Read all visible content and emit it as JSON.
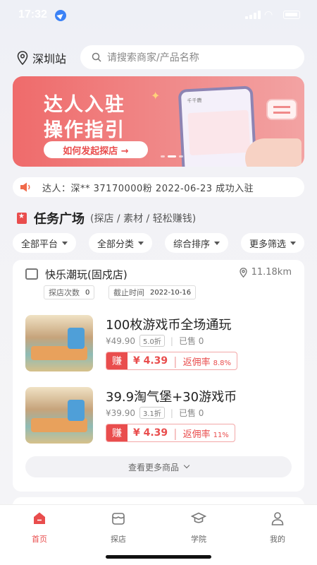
{
  "status": {
    "time": "17:32"
  },
  "header": {
    "city": "深圳站",
    "search_placeholder": "请搜索商家/产品名称"
  },
  "banner": {
    "title_line1": "达人入驻",
    "title_line2": "操作指引",
    "button": "如何发起探店 →",
    "phone_header": "千千鹿"
  },
  "notice": {
    "text": "达人：深**  37170000粉  2022-06-23 成功入驻"
  },
  "section": {
    "title": "任务广场",
    "subtitle": "(探店 / 素材 / 轻松赚钱)"
  },
  "filters": [
    "全部平台",
    "全部分类",
    "综合排序",
    "更多筛选"
  ],
  "store": {
    "name": "快乐潮玩(固戍店)",
    "distance": "11.18km",
    "visits_label": "探店次数",
    "visits_value": "0",
    "deadline_label": "截止时间",
    "deadline_value": "2022-10-16",
    "products": [
      {
        "title": "100枚游戏币全场通玩",
        "price": "¥49.90",
        "discount": "5.0折",
        "sold": "已售 0",
        "earn_tag": "赚",
        "earn": "¥ 4.39",
        "rate_label": "返佣率",
        "rate": "8.8%"
      },
      {
        "title": "39.9淘气堡+30游戏币",
        "price": "¥39.90",
        "discount": "3.1折",
        "sold": "已售 0",
        "earn_tag": "赚",
        "earn": "¥ 4.39",
        "rate_label": "返佣率",
        "rate": "11%"
      }
    ],
    "more": "查看更多商品"
  },
  "tabs": [
    {
      "label": "首页",
      "icon": "home-icon",
      "active": true
    },
    {
      "label": "探店",
      "icon": "store-icon",
      "active": false
    },
    {
      "label": "学院",
      "icon": "graduation-cap-icon",
      "active": false
    },
    {
      "label": "我的",
      "icon": "user-icon",
      "active": false
    }
  ],
  "colors": {
    "accent": "#e94d4d",
    "banner": "#ef6b6b"
  }
}
